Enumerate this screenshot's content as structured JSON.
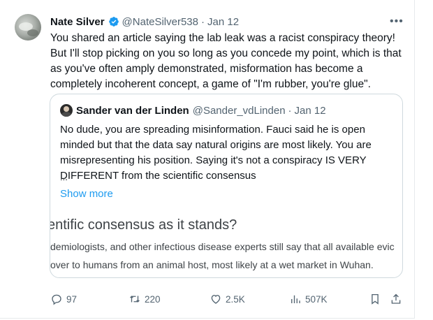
{
  "tweet": {
    "author_name": "Nate Silver",
    "author_handle": "@NateSilver538",
    "separator": "·",
    "date": "Jan 12",
    "more_icon": "more-icon",
    "text": "You shared an article saying the lab leak was a racist conspiracy theory! But I'll stop picking on you so long as you concede my point, which is that as you've often amply demonstrated, misformation has become a completely incoherent concept, a game of \"I'm rubber, you're glue\"."
  },
  "quote": {
    "author_name": "Sander van der Linden",
    "author_handle": "@Sander_vdLinden",
    "separator": "·",
    "date": "Jan 12",
    "text": "No dude, you are spreading misinformation. Fauci said he is open minded but that the data say natural origins are most likely. You are misrepresenting his position. Saying it's not a conspiracy IS VERY DIFFERENT from the scientific consensus",
    "ellipsis": "...",
    "show_more": "Show more",
    "article_title": "entific consensus as it stands?",
    "article_lines": [
      "demiologists, and other infectious disease experts still say that all available evic",
      "over to humans from an animal host, most likely at a wet market in Wuhan."
    ]
  },
  "actions": {
    "replies": "97",
    "retweets": "220",
    "likes": "2.5K",
    "views": "507K"
  },
  "colors": {
    "accent": "#1d9bf0",
    "text": "#0f1419",
    "muted": "#536471",
    "border": "#cfd9de"
  }
}
